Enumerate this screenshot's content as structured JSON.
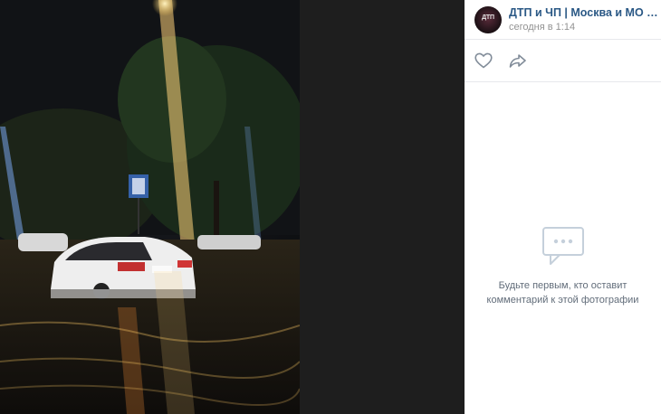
{
  "post": {
    "author": "ДТП и ЧП | Москва и МО Онлайн ...",
    "date": "сегодня в 1:14",
    "avatar_text": "ДТП"
  },
  "actions": {
    "like_icon": "heart-icon",
    "share_icon": "share-arrow-icon"
  },
  "comments": {
    "empty_line1": "Будьте первым, кто оставит",
    "empty_line2": "комментарий к этой фотографии",
    "empty_icon": "comments-icon"
  },
  "colors": {
    "author_link": "#2a5885",
    "muted": "#939393",
    "divider": "#e7e8ec",
    "icon": "#818c99"
  }
}
